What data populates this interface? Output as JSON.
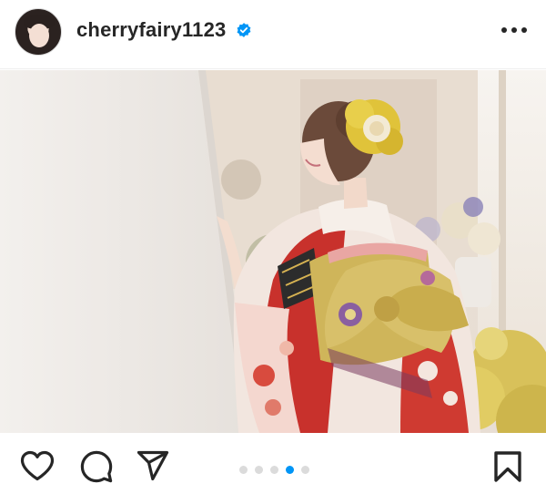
{
  "post": {
    "username": "cherryfairy1123",
    "verified": true,
    "more_icon": "more-horizontal-icon",
    "carousel": {
      "total_slides": 5,
      "active_slide": 4
    },
    "actions": {
      "like_icon": "heart-icon",
      "comment_icon": "comment-bubble-icon",
      "share_icon": "paper-plane-icon",
      "save_icon": "bookmark-icon"
    },
    "colors": {
      "accent": "#0095f6",
      "text": "#262626",
      "divider": "#efefef",
      "inactive_dot": "#dbdbdb"
    }
  }
}
